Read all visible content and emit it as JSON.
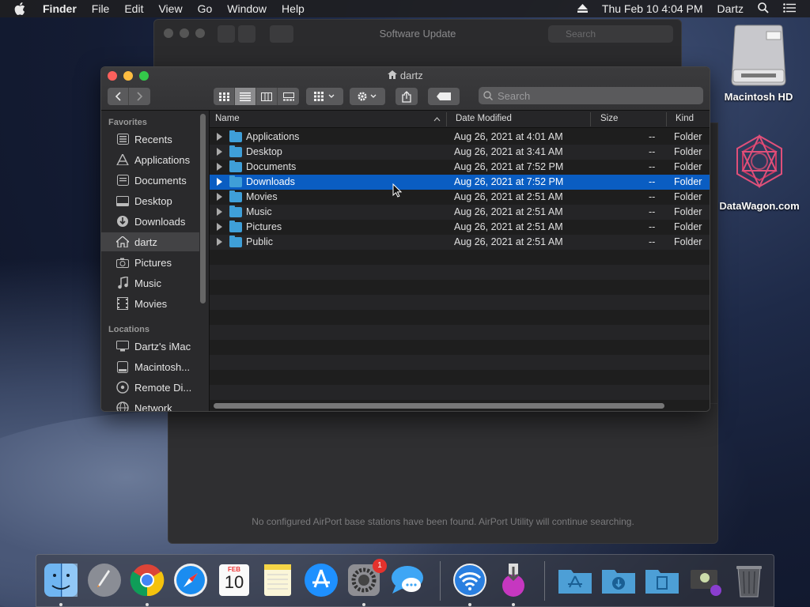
{
  "menubar": {
    "app": "Finder",
    "items": [
      "File",
      "Edit",
      "View",
      "Go",
      "Window",
      "Help"
    ],
    "clock": "Thu Feb 10  4:04 PM",
    "user": "Dartz"
  },
  "bg_window": {
    "title": "Software Update",
    "search_placeholder": "Search",
    "message": "No configured AirPort base stations have been found. AirPort Utility will continue searching."
  },
  "finder": {
    "title": "dartz",
    "search_placeholder": "Search",
    "sidebar": {
      "favorites_header": "Favorites",
      "favorites": [
        {
          "label": "Recents",
          "icon": "recents-icon"
        },
        {
          "label": "Applications",
          "icon": "applications-icon"
        },
        {
          "label": "Documents",
          "icon": "documents-icon"
        },
        {
          "label": "Desktop",
          "icon": "desktop-icon"
        },
        {
          "label": "Downloads",
          "icon": "downloads-icon"
        },
        {
          "label": "dartz",
          "icon": "home-icon",
          "selected": true
        },
        {
          "label": "Pictures",
          "icon": "pictures-icon"
        },
        {
          "label": "Music",
          "icon": "music-icon"
        },
        {
          "label": "Movies",
          "icon": "movies-icon"
        }
      ],
      "locations_header": "Locations",
      "locations": [
        {
          "label": "Dartz's iMac",
          "icon": "imac-icon"
        },
        {
          "label": "Macintosh...",
          "icon": "disk-icon"
        },
        {
          "label": "Remote Di...",
          "icon": "remote-disc-icon"
        },
        {
          "label": "Network",
          "icon": "network-icon"
        }
      ]
    },
    "columns": {
      "name": "Name",
      "date": "Date Modified",
      "size": "Size",
      "kind": "Kind"
    },
    "rows": [
      {
        "name": "Applications",
        "date": "Aug 26, 2021 at 4:01 AM",
        "size": "--",
        "kind": "Folder"
      },
      {
        "name": "Desktop",
        "date": "Aug 26, 2021 at 3:41 AM",
        "size": "--",
        "kind": "Folder"
      },
      {
        "name": "Documents",
        "date": "Aug 26, 2021 at 7:52 PM",
        "size": "--",
        "kind": "Folder"
      },
      {
        "name": "Downloads",
        "date": "Aug 26, 2021 at 7:52 PM",
        "size": "--",
        "kind": "Folder",
        "selected": true
      },
      {
        "name": "Movies",
        "date": "Aug 26, 2021 at 2:51 AM",
        "size": "--",
        "kind": "Folder"
      },
      {
        "name": "Music",
        "date": "Aug 26, 2021 at 2:51 AM",
        "size": "--",
        "kind": "Folder"
      },
      {
        "name": "Pictures",
        "date": "Aug 26, 2021 at 2:51 AM",
        "size": "--",
        "kind": "Folder"
      },
      {
        "name": "Public",
        "date": "Aug 26, 2021 at 2:51 AM",
        "size": "--",
        "kind": "Folder"
      }
    ]
  },
  "desktop": {
    "hd_label": "Macintosh HD",
    "datawagon_label": "DataWagon.com"
  },
  "dock": {
    "apps": [
      "finder-icon",
      "launchpad-icon",
      "chrome-icon",
      "safari-icon",
      "calendar-icon",
      "notes-icon",
      "app-store-icon",
      "system-preferences-icon",
      "messages-icon",
      "airport-utility-icon",
      "installer-icon"
    ],
    "calendar_month": "FEB",
    "calendar_day": "10",
    "prefs_badge": "1",
    "stacks": [
      "applications-stack-icon",
      "downloads-stack-icon",
      "documents-stack-icon",
      "screen-recorder-icon",
      "trash-icon"
    ]
  }
}
